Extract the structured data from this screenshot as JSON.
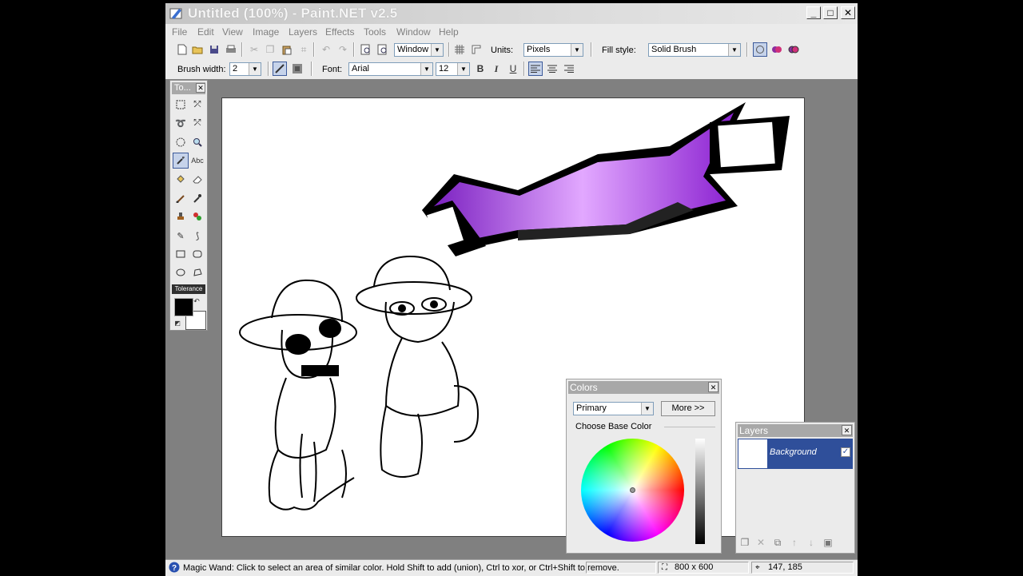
{
  "window": {
    "title": "Untitled (100%) - Paint.NET v2.5",
    "minimize": "_",
    "maximize": "□",
    "close": "✕"
  },
  "menu": [
    "File",
    "Edit",
    "View",
    "Image",
    "Layers",
    "Effects",
    "Tools",
    "Window",
    "Help"
  ],
  "toolbar": {
    "zoom_value": "Window",
    "units_label": "Units:",
    "units_value": "Pixels",
    "fill_label": "Fill style:",
    "fill_value": "Solid Brush",
    "brush_label": "Brush width:",
    "brush_value": "2",
    "font_label": "Font:",
    "font_value": "Arial",
    "size_value": "12",
    "bold": "B",
    "italic": "I",
    "underline": "U"
  },
  "tools": {
    "header": "To...",
    "close": "✕",
    "tolerance": "Tolerance"
  },
  "colors_panel": {
    "title": "Colors",
    "close": "✕",
    "select_value": "Primary",
    "more_button": "More >>",
    "section_label": "Choose Base Color"
  },
  "layers_panel": {
    "title": "Layers",
    "close": "✕",
    "layer_name": "Background"
  },
  "status": {
    "message": "Magic Wand: Click to select an area of similar color. Hold Shift to add (union), Ctrl to xor, or Ctrl+Shift to remove.",
    "image_size": "800 x 600",
    "cursor_pos": "147, 185"
  },
  "colors": {
    "primary": "#000000",
    "secondary": "#ffffff",
    "accent_purple": "#9b2fd6",
    "selection_blue": "#2f4f9a"
  }
}
